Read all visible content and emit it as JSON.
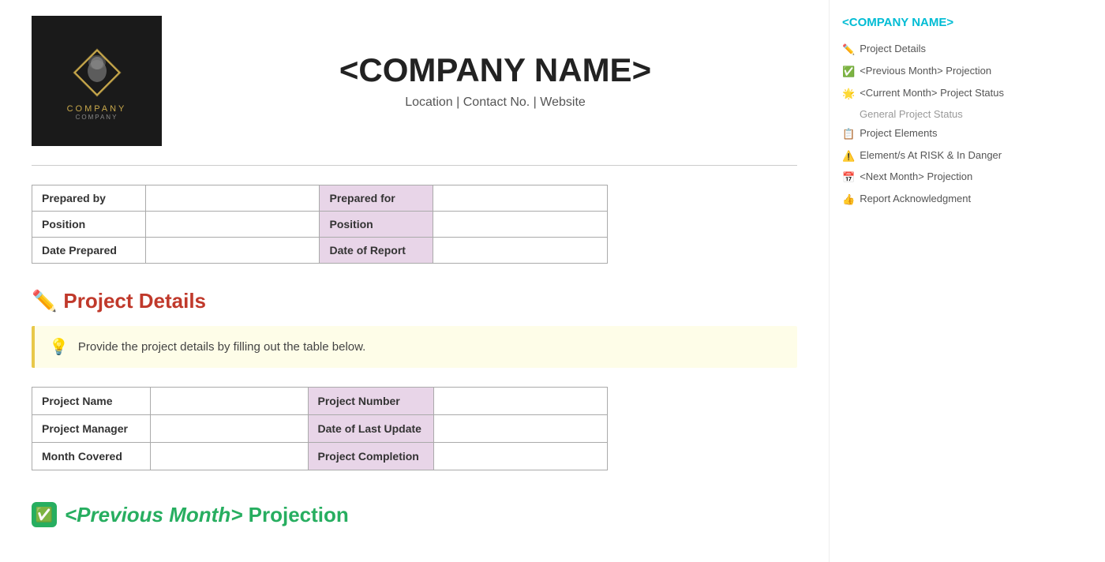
{
  "company": {
    "name": "<COMPANY NAME>",
    "contact": "Location | Contact No. | Website",
    "logo_text": "COMPANY",
    "logo_subtext": "COMPANY"
  },
  "header_table": {
    "rows": [
      {
        "label1": "Prepared by",
        "value1": "",
        "label2": "Prepared for",
        "value2": ""
      },
      {
        "label1": "Position",
        "value1": "",
        "label2": "Position",
        "value2": ""
      },
      {
        "label1": "Date Prepared",
        "value1": "",
        "label2": "Date of Report",
        "value2": ""
      }
    ]
  },
  "project_details": {
    "heading": "Project Details",
    "icon": "✏️",
    "hint": "Provide the project details by filling out the table below.",
    "hint_icon": "💡",
    "rows": [
      {
        "label1": "Project Name",
        "value1": "",
        "label2": "Project Number",
        "value2": ""
      },
      {
        "label1": "Project Manager",
        "value1": "",
        "label2": "Date of Last Update",
        "value2": ""
      },
      {
        "label1": "Month Covered",
        "value1": "",
        "label2": "Project Completion",
        "value2": ""
      }
    ]
  },
  "prev_month": {
    "icon": "✅",
    "text_before": "",
    "text_italic": "<Previous Month>",
    "text_after": " Projection"
  },
  "sidebar": {
    "company_name": "<COMPANY NAME>",
    "nav_items": [
      {
        "icon": "✏️",
        "label": "Project Details"
      },
      {
        "icon": "✅",
        "label": "<Previous Month> Projection"
      },
      {
        "icon": "🌟",
        "label": "<Current Month> Project Status"
      },
      {
        "icon": "",
        "label": "General Project Status",
        "sub": true
      },
      {
        "icon": "📋",
        "label": "Project Elements"
      },
      {
        "icon": "⚠️",
        "label": "Element/s At RISK & In Danger"
      },
      {
        "icon": "📅",
        "label": "<Next Month> Projection"
      },
      {
        "icon": "👍",
        "label": "Report Acknowledgment"
      }
    ]
  }
}
